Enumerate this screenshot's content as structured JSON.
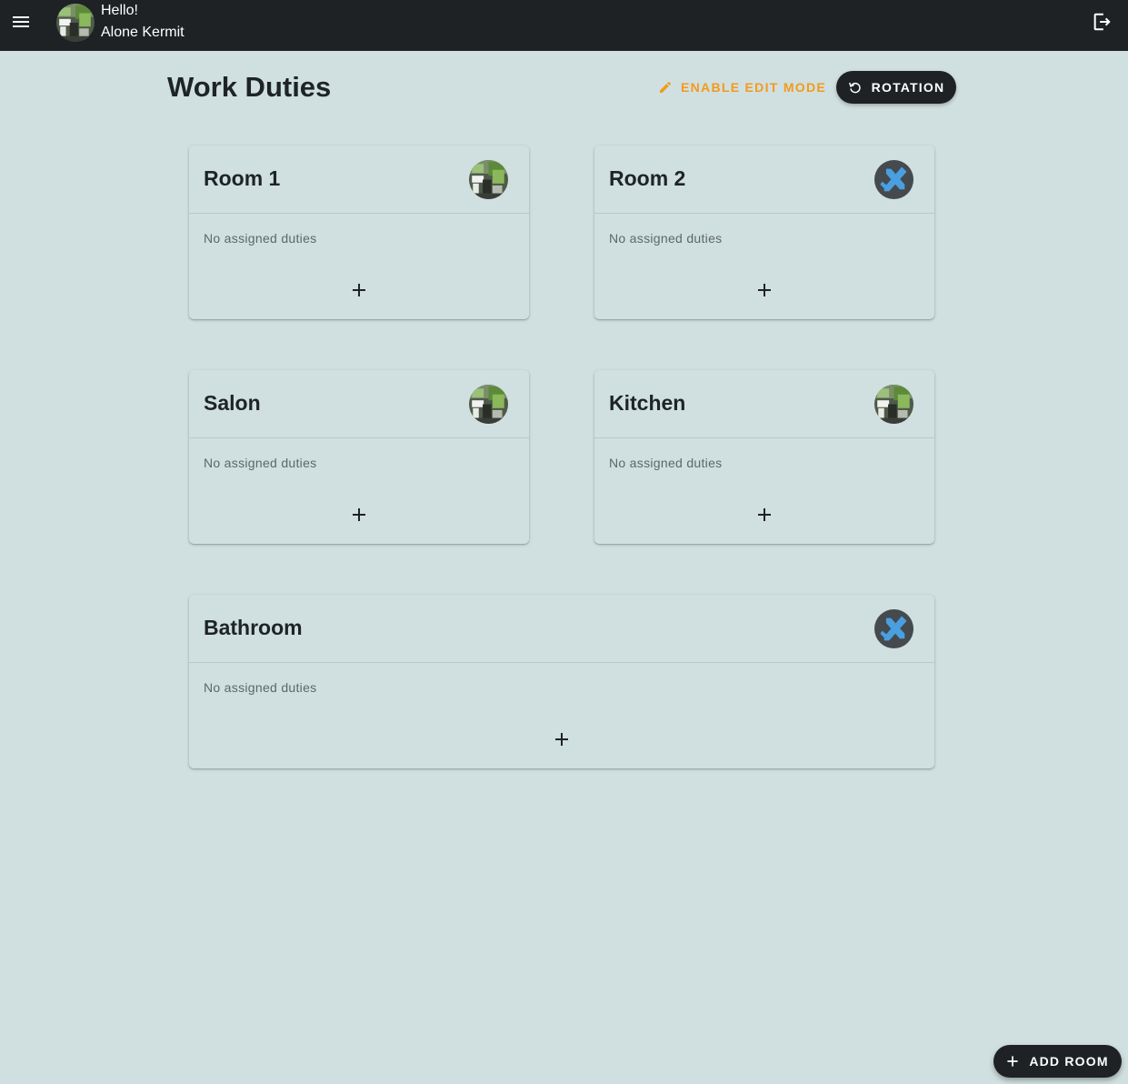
{
  "header": {
    "greeting": "Hello!",
    "user_name": "Alone Kermit"
  },
  "page": {
    "title": "Work Duties",
    "edit_mode_label": "ENABLE EDIT MODE",
    "rotation_label": "ROTATION"
  },
  "rooms": [
    {
      "name": "Room 1",
      "avatar": "photo-avatar",
      "empty_text": "No assigned duties"
    },
    {
      "name": "Room 2",
      "avatar": "tool-logo-avatar",
      "empty_text": "No assigned duties"
    },
    {
      "name": "Salon",
      "avatar": "photo-avatar",
      "empty_text": "No assigned duties"
    },
    {
      "name": "Kitchen",
      "avatar": "photo-avatar",
      "empty_text": "No assigned duties"
    },
    {
      "name": "Bathroom",
      "avatar": "tool-logo-avatar",
      "empty_text": "No assigned duties"
    }
  ],
  "fab": {
    "add_room_label": "ADD ROOM"
  },
  "colors": {
    "background": "#d0dfdf",
    "topbar": "#1e2224",
    "accent": "#f39a1c",
    "logo_blue": "#4a9fe0"
  },
  "icons": [
    "menu-icon",
    "logout-icon",
    "pencil-icon",
    "rotate-icon",
    "plus-icon"
  ]
}
